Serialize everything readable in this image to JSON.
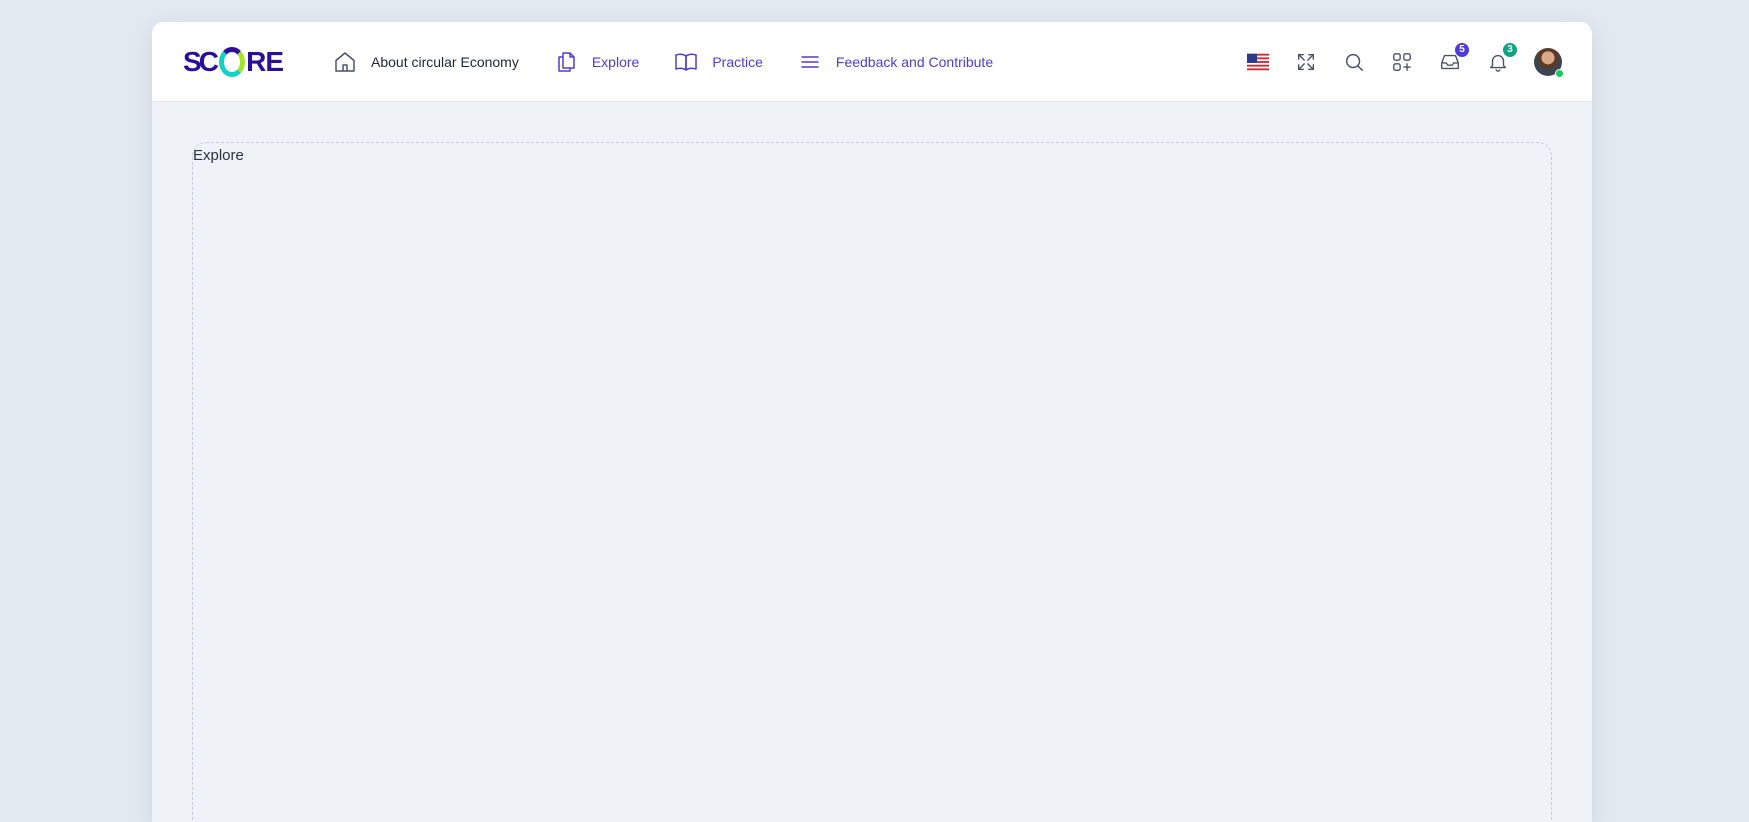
{
  "header": {
    "logo": {
      "part1": "S",
      "part2": "C",
      "part3": "RE"
    },
    "nav": [
      {
        "label": "About circular Economy",
        "icon": "home-icon"
      },
      {
        "label": "Explore",
        "icon": "documents-icon"
      },
      {
        "label": "Practice",
        "icon": "book-icon"
      },
      {
        "label": "Feedback and Contribute",
        "icon": "menu-icon"
      }
    ],
    "actions": {
      "language": "flag-us-icon",
      "fullscreen": "fullscreen-icon",
      "search": "search-icon",
      "apps": "apps-add-icon",
      "inbox": {
        "icon": "inbox-icon",
        "count": "5"
      },
      "notifications": {
        "icon": "bell-icon",
        "count": "3"
      },
      "avatar": "avatar"
    }
  },
  "main": {
    "panel_title": "Explore"
  },
  "colors": {
    "accent": "#4f3bd6",
    "logo_primary": "#2b0f9a",
    "logo_teal": "#12d3c2",
    "notification_badge": "#10a37f",
    "background": "#eff3f8"
  }
}
